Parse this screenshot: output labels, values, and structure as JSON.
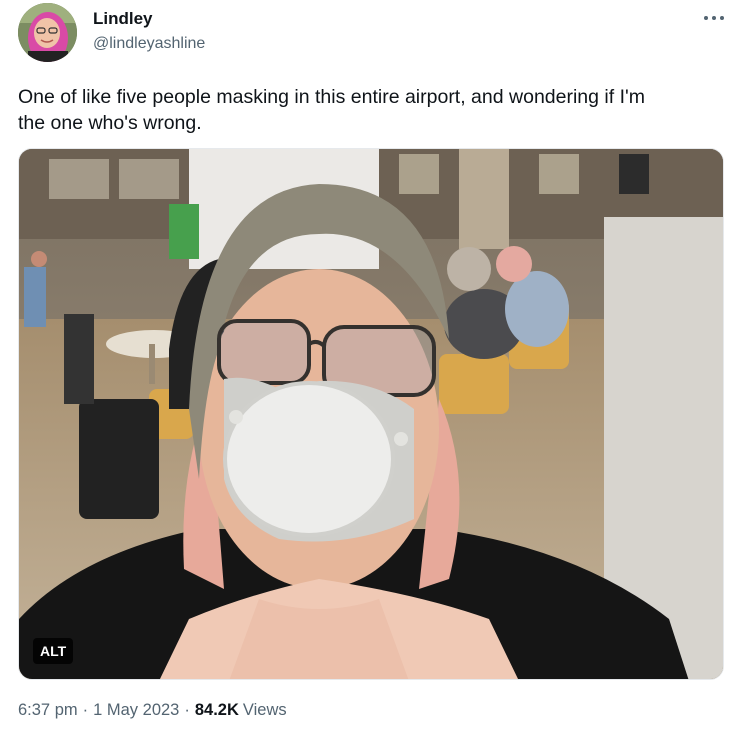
{
  "author": {
    "name": "Lindley",
    "handle": "@lindleyashline"
  },
  "tweet": {
    "text": "One of like five people masking in this entire airport, and wondering if I'm\nthe one who's wrong.",
    "media": {
      "alt_label": "ALT"
    },
    "time": "6:37 pm",
    "date": "1 May 2023",
    "separator": "·",
    "views_count": "84.2K",
    "views_label": "Views"
  },
  "icons": {
    "more": "more-horizontal-icon"
  },
  "colors": {
    "text_primary": "#0f1419",
    "text_secondary": "#536471"
  }
}
